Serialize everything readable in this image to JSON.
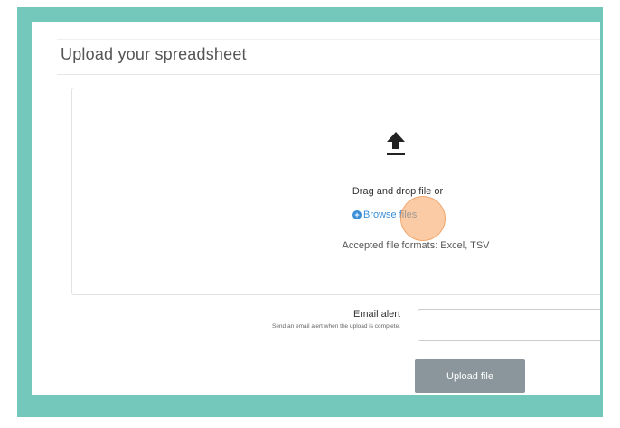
{
  "panel": {
    "title": "Upload your spreadsheet"
  },
  "dropzone": {
    "icon": "upload-arrow-icon",
    "drag_text": "Drag and drop file or",
    "browse_label": "Browse files",
    "formats_text": "Accepted file formats: Excel, TSV"
  },
  "email_alert": {
    "label": "Email alert",
    "help": "Send an email alert when the upload is complete.",
    "value": ""
  },
  "actions": {
    "upload_label": "Upload file"
  },
  "colors": {
    "frame": "#74c8bb",
    "link": "#3b8fd9",
    "button": "#8a959c",
    "click_indicator": "#f5a05a"
  }
}
